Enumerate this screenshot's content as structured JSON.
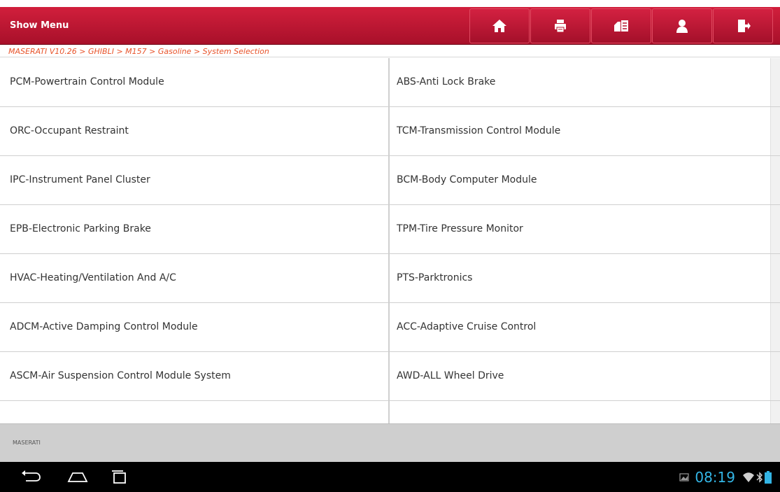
{
  "header": {
    "title": "Show Menu",
    "toolbar": [
      {
        "name": "home-button",
        "icon": "home-icon"
      },
      {
        "name": "print-button",
        "icon": "printer-icon"
      },
      {
        "name": "report-button",
        "icon": "report-icon"
      },
      {
        "name": "user-button",
        "icon": "user-icon"
      },
      {
        "name": "exit-button",
        "icon": "exit-icon"
      }
    ]
  },
  "breadcrumb": "MASERATI V10.26 > GHIBLI > M157 > Gasoline > System Selection",
  "systems": [
    [
      "PCM-Powertrain Control Module",
      "ABS-Anti Lock Brake"
    ],
    [
      "ORC-Occupant Restraint",
      "TCM-Transmission Control Module"
    ],
    [
      "IPC-Instrument Panel Cluster",
      "BCM-Body Computer Module"
    ],
    [
      "EPB-Electronic Parking Brake",
      "TPM-Tire Pressure Monitor"
    ],
    [
      "HVAC-Heating/Ventilation And A/C",
      "PTS-Parktronics"
    ],
    [
      "ADCM-Active Damping Control Module",
      "ACC-Adaptive Cruise Control"
    ],
    [
      "ASCM-Air Suspension Control Module System",
      "AWD-ALL Wheel Drive"
    ],
    [
      "",
      ""
    ]
  ],
  "footer": {
    "brand": "MASERATI"
  },
  "statusbar": {
    "time": "08:19"
  },
  "colors": {
    "header": "#b8142f",
    "breadcrumb": "#e8532a",
    "clock": "#33b5e5"
  }
}
